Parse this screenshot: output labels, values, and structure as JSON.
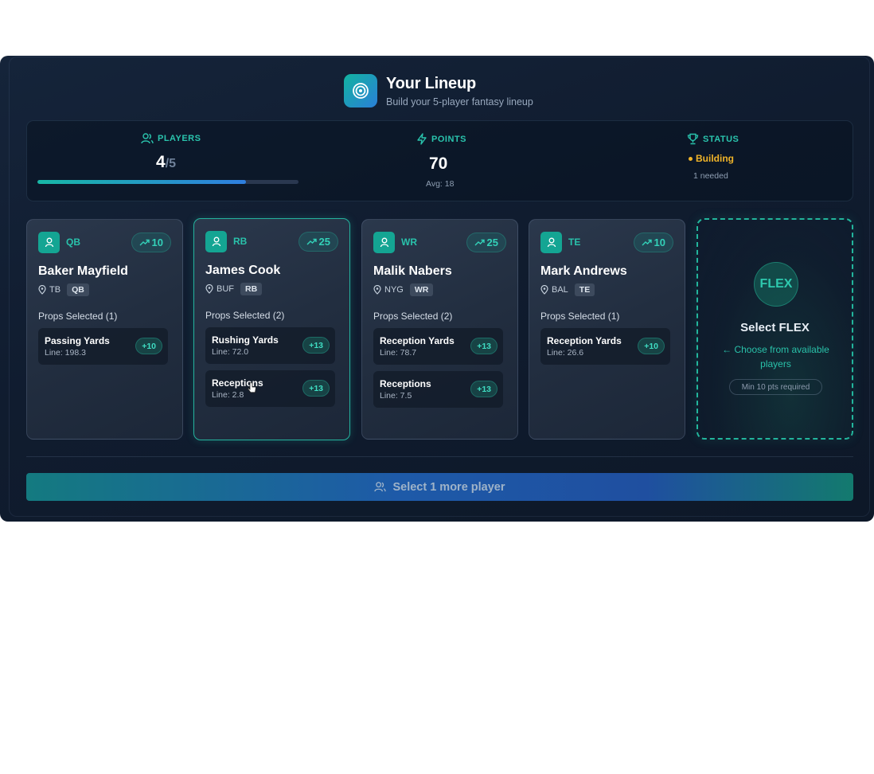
{
  "header": {
    "title": "Your Lineup",
    "subtitle": "Build your 5-player fantasy lineup",
    "logo_icon": "target-icon"
  },
  "stats": {
    "players": {
      "label": "PLAYERS",
      "count": "4",
      "total": "/5",
      "progress_fraction": 0.8
    },
    "points": {
      "label": "POINTS",
      "value": "70",
      "avg": "Avg: 18"
    },
    "status": {
      "label": "STATUS",
      "value": "Building",
      "sub": "1 needed",
      "color": "#f0b429"
    }
  },
  "cards": [
    {
      "position": "QB",
      "points": "10",
      "name": "Baker Mayfield",
      "team": "TB",
      "chip": "QB",
      "props_title": "Props Selected (1)",
      "props": [
        {
          "name": "Passing Yards",
          "line": "Line: 198.3",
          "pts": "+10"
        }
      ]
    },
    {
      "position": "RB",
      "points": "25",
      "name": "James Cook",
      "team": "BUF",
      "chip": "RB",
      "props_title": "Props Selected (2)",
      "props": [
        {
          "name": "Rushing Yards",
          "line": "Line: 72.0",
          "pts": "+13"
        },
        {
          "name": "Receptions",
          "line": "Line: 2.8",
          "pts": "+13"
        }
      ]
    },
    {
      "position": "WR",
      "points": "25",
      "name": "Malik Nabers",
      "team": "NYG",
      "chip": "WR",
      "props_title": "Props Selected (2)",
      "props": [
        {
          "name": "Reception Yards",
          "line": "Line: 78.7",
          "pts": "+13"
        },
        {
          "name": "Receptions",
          "line": "Line: 7.5",
          "pts": "+13"
        }
      ]
    },
    {
      "position": "TE",
      "points": "10",
      "name": "Mark Andrews",
      "team": "BAL",
      "chip": "TE",
      "props_title": "Props Selected (1)",
      "props": [
        {
          "name": "Reception Yards",
          "line": "Line: 26.6",
          "pts": "+10"
        }
      ]
    }
  ],
  "flex": {
    "badge": "FLEX",
    "title": "Select FLEX",
    "hint": "← Choose from available players",
    "min": "Min 10 pts required"
  },
  "cta": {
    "label": "Select 1 more player"
  },
  "colors": {
    "accent": "#22b59c",
    "status": "#f0b429",
    "cta_start": "#147a80",
    "cta_mid": "#1e5aa8"
  }
}
